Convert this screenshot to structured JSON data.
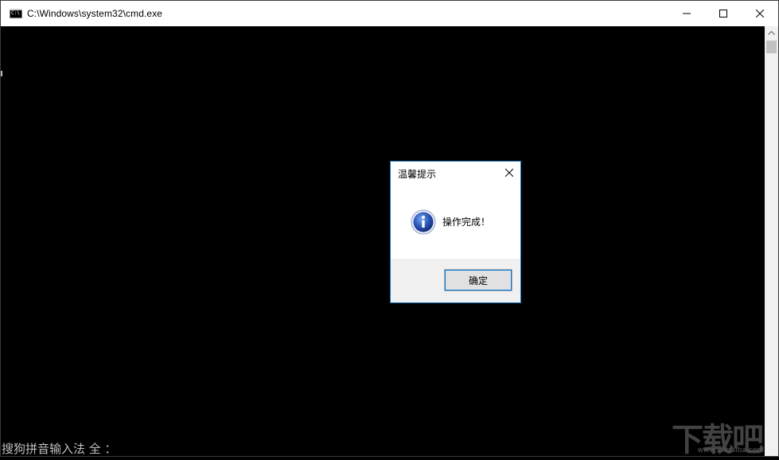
{
  "window": {
    "title": "C:\\Windows\\system32\\cmd.exe",
    "app_icon": "cmd-console-icon",
    "app_icon_text": "C:\\",
    "controls": [
      "minimize-icon",
      "maximize-icon",
      "close-icon"
    ]
  },
  "console": {
    "ime_status": "搜狗拼音输入法 全 ："
  },
  "dialog": {
    "title": "温馨提示",
    "close_icon": "close-icon",
    "icon": "info-icon",
    "message": "操作完成！",
    "ok_label": "确定"
  },
  "watermark": {
    "text": "下载吧",
    "url": "www.xiazaiba.com"
  },
  "colors": {
    "console_bg": "#000000",
    "titlebar_bg": "#ffffff",
    "dialog_border": "#1a6fb5",
    "button_focus": "#0078d7",
    "info_icon": "#2a56b8"
  }
}
